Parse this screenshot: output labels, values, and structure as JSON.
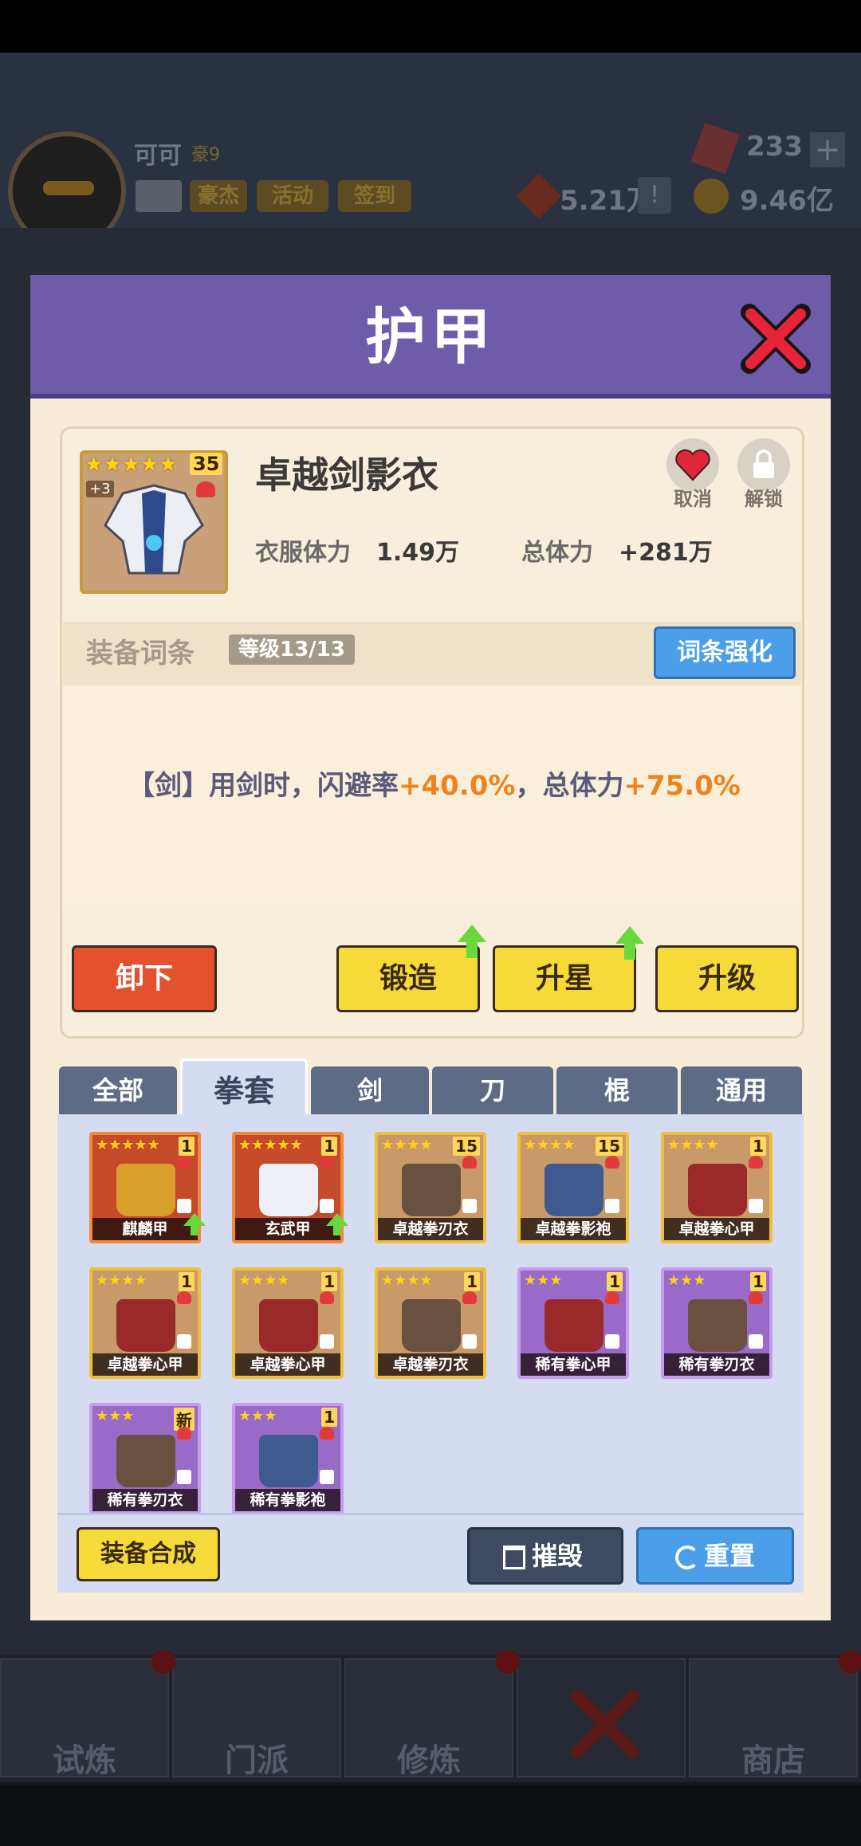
{
  "hud": {
    "player_name": "可可",
    "player_tag": "豪9",
    "buttons": [
      "豪杰",
      "活动",
      "签到"
    ],
    "gems": "233",
    "power": "5.21万",
    "coins": "9.46亿"
  },
  "nav": {
    "items": [
      "试炼",
      "门派",
      "修炼",
      "",
      "商店"
    ]
  },
  "modal": {
    "title": "护甲",
    "item": {
      "name": "卓越剑影衣",
      "stars": "★★★★★",
      "level": "35",
      "plus": "+3",
      "stat1_label": "衣服体力",
      "stat1_value": "1.49万",
      "stat2_label": "总体力",
      "stat2_value": "+281万",
      "cancel_label": "取消",
      "unlock_label": "解锁"
    },
    "affix": {
      "section_label": "装备词条",
      "level_chip": "等级13/13",
      "enhance_button": "词条强化",
      "text_prefix": "【剑】用剑时，闪避率",
      "value1": "+40.0%",
      "text_mid": "，总体力",
      "value2": "+75.0%"
    },
    "actions": {
      "unequip": "卸下",
      "forge": "锻造",
      "star_up": "升星",
      "upgrade": "升级"
    },
    "tabs": [
      "全部",
      "拳套",
      "剑",
      "刀",
      "棍",
      "通用"
    ],
    "active_tab": "拳套",
    "cards": [
      {
        "name": "麒麟甲",
        "stars": "★★★★★",
        "num": "1",
        "rarity": "red",
        "robe_color": "#d8a02a",
        "upgrade": true
      },
      {
        "name": "玄武甲",
        "stars": "★★★★★",
        "num": "1",
        "rarity": "red",
        "robe_color": "#eef0f6",
        "upgrade": true
      },
      {
        "name": "卓越拳刃衣",
        "stars": "★★★★",
        "num": "15",
        "rarity": "gold",
        "robe_color": "#6a5040"
      },
      {
        "name": "卓越拳影袍",
        "stars": "★★★★",
        "num": "15",
        "rarity": "gold",
        "robe_color": "#3e5a90"
      },
      {
        "name": "卓越拳心甲",
        "stars": "★★★★",
        "num": "1",
        "rarity": "gold",
        "robe_color": "#9a2a2a"
      },
      {
        "name": "卓越拳心甲",
        "stars": "★★★★",
        "num": "1",
        "rarity": "gold",
        "robe_color": "#9a2a2a"
      },
      {
        "name": "卓越拳心甲",
        "stars": "★★★★",
        "num": "1",
        "rarity": "gold",
        "robe_color": "#9a2a2a"
      },
      {
        "name": "卓越拳刃衣",
        "stars": "★★★★",
        "num": "1",
        "rarity": "gold",
        "robe_color": "#6a5040"
      },
      {
        "name": "稀有拳心甲",
        "stars": "★★★",
        "num": "1",
        "rarity": "purple",
        "robe_color": "#9a2a2a"
      },
      {
        "name": "稀有拳刃衣",
        "stars": "★★★",
        "num": "1",
        "rarity": "purple",
        "robe_color": "#6a5040"
      },
      {
        "name": "稀有拳刃衣",
        "stars": "★★★",
        "num": "新",
        "rarity": "purple",
        "robe_color": "#6a5040"
      },
      {
        "name": "稀有拳影袍",
        "stars": "★★★",
        "num": "1",
        "rarity": "purple",
        "robe_color": "#3e5a90"
      }
    ],
    "bottom": {
      "synthesize": "装备合成",
      "destroy": "摧毁",
      "reset": "重置"
    }
  },
  "colors": {
    "header": "#6e5ba9",
    "highlight": "#f0821e",
    "panel": "#f6ecd7",
    "grid_bg": "#d5dcf2"
  }
}
